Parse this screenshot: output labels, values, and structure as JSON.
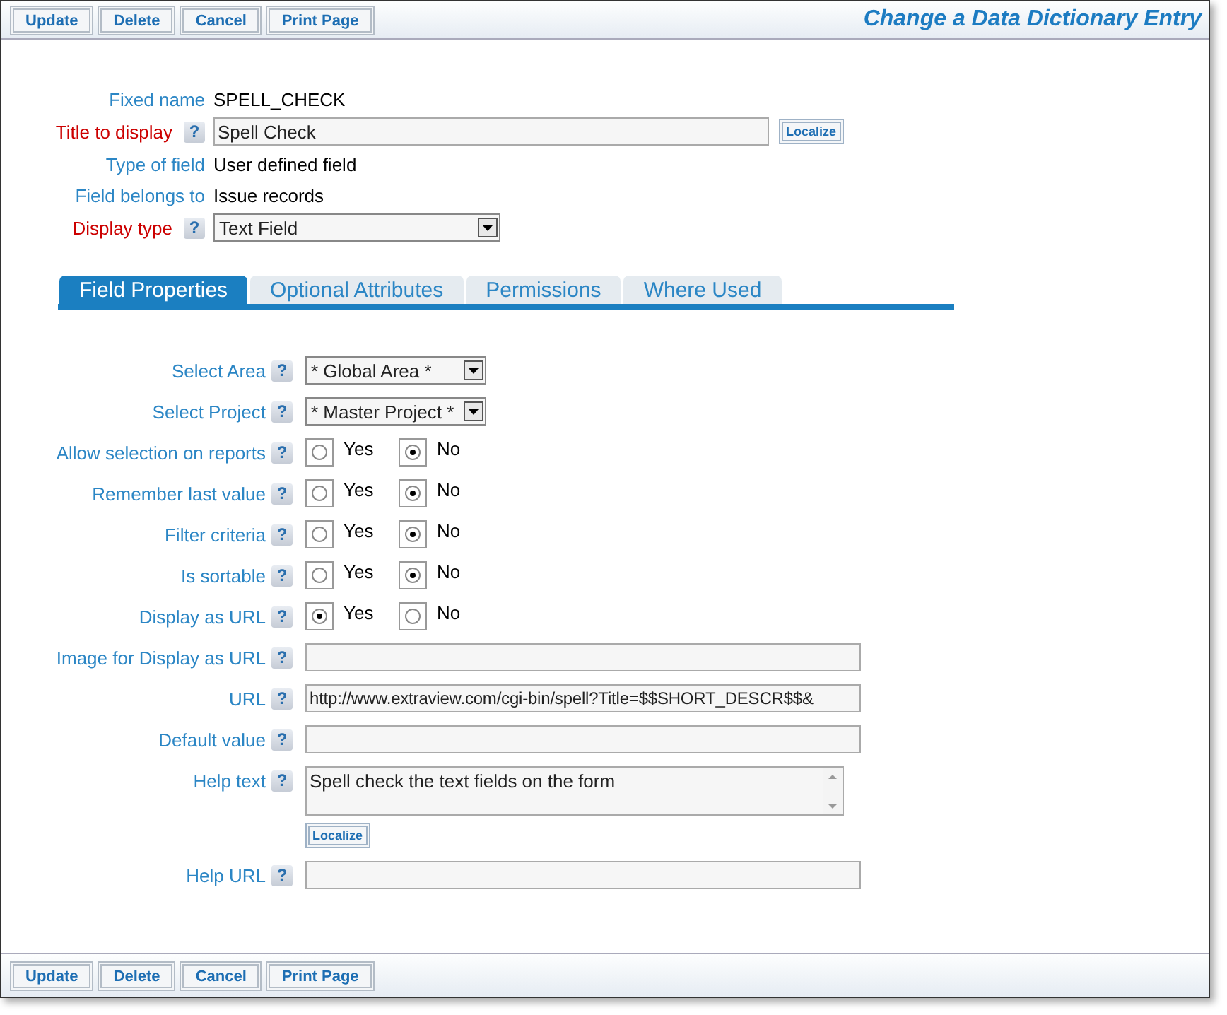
{
  "toolbar_top": {
    "buttons": [
      "Update",
      "Delete",
      "Cancel",
      "Print Page"
    ],
    "title": "Change a Data Dictionary Entry"
  },
  "header_fields": [
    {
      "kind": "text",
      "label": "Fixed name",
      "required": false,
      "value": "SPELL_CHECK"
    },
    {
      "kind": "input",
      "label": "Title to display",
      "required": true,
      "help": "?",
      "value": "Spell Check",
      "action": "Localize"
    },
    {
      "kind": "text",
      "label": "Type of field",
      "required": false,
      "value": "User defined field"
    },
    {
      "kind": "text",
      "label": "Field belongs to",
      "required": false,
      "value": "Issue records"
    },
    {
      "kind": "select",
      "label": "Display type",
      "required": true,
      "help": "?",
      "value": "Text Field"
    }
  ],
  "tabs": [
    {
      "label": "Field Properties",
      "selected": true
    },
    {
      "label": "Optional Attributes",
      "selected": false
    },
    {
      "label": "Permissions",
      "selected": false
    },
    {
      "label": "Where Used",
      "selected": false
    }
  ],
  "fields": [
    {
      "kind": "select",
      "label": "Select Area",
      "help": "?",
      "value": "* Global Area *"
    },
    {
      "kind": "select",
      "label": "Select Project",
      "help": "?",
      "value": "* Master Project *"
    },
    {
      "kind": "radio",
      "label": "Allow selection on reports",
      "help": "?",
      "options": [
        {
          "label": "Yes",
          "selected": false
        },
        {
          "label": "No",
          "selected": true
        }
      ]
    },
    {
      "kind": "radio",
      "label": "Remember last value",
      "help": "?",
      "options": [
        {
          "label": "Yes",
          "selected": false
        },
        {
          "label": "No",
          "selected": true
        }
      ]
    },
    {
      "kind": "radio",
      "label": "Filter criteria",
      "help": "?",
      "options": [
        {
          "label": "Yes",
          "selected": false
        },
        {
          "label": "No",
          "selected": true
        }
      ]
    },
    {
      "kind": "radio",
      "label": "Is sortable",
      "help": "?",
      "options": [
        {
          "label": "Yes",
          "selected": false
        },
        {
          "label": "No",
          "selected": true
        }
      ]
    },
    {
      "kind": "radio",
      "label": "Display as URL",
      "help": "?",
      "options": [
        {
          "label": "Yes",
          "selected": true
        },
        {
          "label": "No",
          "selected": false
        }
      ]
    },
    {
      "kind": "input",
      "label": "Image for Display as URL",
      "help": "?"
    },
    {
      "kind": "input",
      "label": "URL",
      "help": "?",
      "value": "http://www.extraview.com/cgi-bin/spell?Title=$$SHORT_DESCR$$&"
    },
    {
      "kind": "input",
      "label": "Default value",
      "help": "?"
    },
    {
      "kind": "textarea",
      "label": "Help text",
      "help": "?",
      "value": "Spell check the text fields on the form",
      "action": "Localize"
    },
    {
      "kind": "input",
      "label": "Help URL",
      "help": "?"
    }
  ],
  "toolbar_bottom": {
    "buttons": [
      "Update",
      "Delete",
      "Cancel",
      "Print Page"
    ]
  }
}
